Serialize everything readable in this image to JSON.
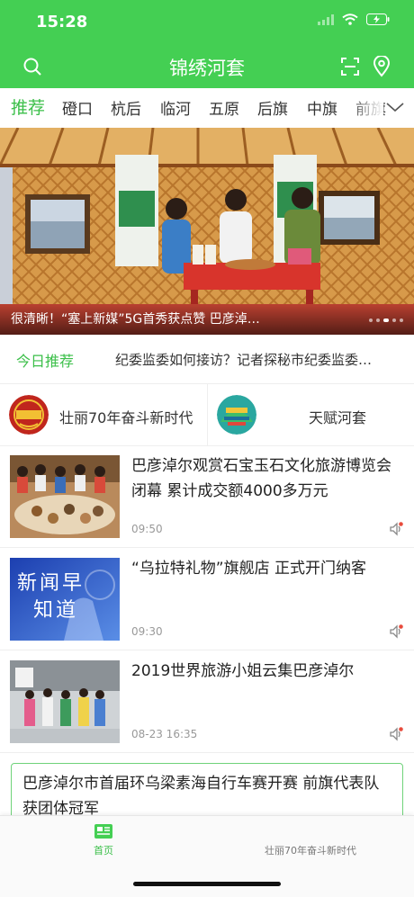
{
  "status_bar": {
    "time": "15:28"
  },
  "header": {
    "title": "锦绣河套"
  },
  "tabs": [
    {
      "label": "推荐",
      "active": true
    },
    {
      "label": "磴口"
    },
    {
      "label": "杭后"
    },
    {
      "label": "临河"
    },
    {
      "label": "五原"
    },
    {
      "label": "后旗"
    },
    {
      "label": "中旗"
    },
    {
      "label": "前旗"
    }
  ],
  "banner": {
    "caption": "很清晰！“塞上新媒”5G首秀获点赞  巴彦淖…",
    "slide_count": 5,
    "active_slide": 3
  },
  "today": {
    "label": "今日推荐",
    "headline": "纪委监委如何接访？记者探秘市纪委监委…"
  },
  "shortcuts": [
    {
      "label": "壮丽70年奋斗新时代",
      "icon": "zhuangli-70-logo"
    },
    {
      "label": "天赋河套",
      "icon": "tianfu-hetao-logo"
    }
  ],
  "news": [
    {
      "title": "巴彦淖尔观赏石宝玉石文化旅游博览会闭幕  累计成交额4000多万元",
      "time": "09:50"
    },
    {
      "title": "“乌拉特礼物”旗舰店 正式开门纳客",
      "time": "09:30",
      "thumb_text": [
        "新闻早",
        "知道"
      ]
    },
    {
      "title": "2019世界旅游小姐云集巴彦淖尔",
      "time": "08-23 16:35"
    }
  ],
  "text_card": {
    "title": "巴彦淖尔市首届环乌梁素海自行车赛开赛  前旗代表队获团体冠军"
  },
  "bottom_tabs": [
    {
      "label": "首页",
      "active": true
    },
    {
      "label": "壮丽70年奋斗新时代"
    }
  ],
  "colors": {
    "brand": "#44cf53",
    "accent_text": "#3bbf49",
    "alert": "#e84b3c"
  }
}
